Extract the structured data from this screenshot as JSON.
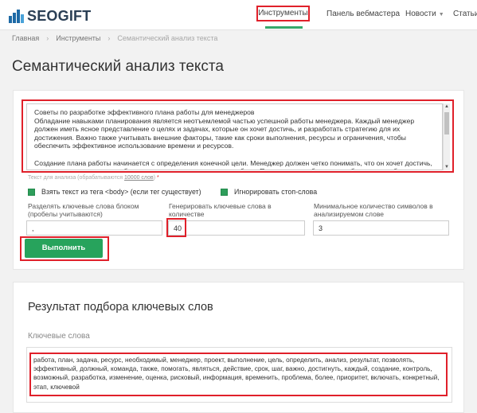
{
  "header": {
    "logo_seo": "SEO",
    "logo_gift": "GIFT",
    "nav": {
      "tools": "Инструменты",
      "webmaster": "Панель вебмастера",
      "news": "Новости",
      "articles": "Статьи"
    }
  },
  "breadcrumb": {
    "home": "Главная",
    "tools": "Инструменты",
    "current": "Семантический анализ текста"
  },
  "page_title": "Семантический анализ текста",
  "analyzer": {
    "text_paragraphs": [
      "Советы по разработке эффективного плана работы для менеджеров\nОбладание навыками планирования является неотъемлемой частью успешной работы менеджера. Каждый менеджер должен иметь ясное представление о целях и задачах, которые он хочет достичь, и разработать стратегию для их достижения. Важно также учитывать внешние факторы, такие как сроки выполнения, ресурсы и ограничения, чтобы обеспечить эффективное использование времени и ресурсов.",
      "Создание плана работы начинается с определения конечной цели. Менеджер должен четко понимать, что он хочет достичь, и какие результаты должны быть достигнуты в результате его работы. После этого необходимо разбить цель на более мелкие"
    ],
    "hint_prefix": "Текст для анализа (обрабатываются ",
    "hint_link": "10000 слов",
    "hint_suffix": ") ",
    "hint_star": "*",
    "checkbox_body": "Взять текст из тега <body> (если тег существует)",
    "checkbox_stopwords": "Игнорировать стоп-слова",
    "label_separator": "Разделять ключевые слова блоком (пробелы учитываются)",
    "label_count": "Генерировать ключевые слова в количестве",
    "label_minlen": "Минимальное количество символов в анализируемом слове",
    "value_separator": ",",
    "value_count": "40",
    "value_minlen": "3",
    "submit_label": "Выполнить"
  },
  "results": {
    "title": "Результат подбора ключевых слов",
    "keywords_label": "Ключевые слова",
    "keywords": "работа, план, задача, ресурс, необходимый, менеджер, проект, выполнение, цель, определить, анализ, результат, позволять, эффективный, должный, команда, также, помогать, являться, действие, срок, шаг, важно, достигнуть, каждый, создание, контроль, возможный, разработка, изменение, оценка, рисковый, информация, временить, проблема, более, приоритет, включать, конкретный, этап, ключевой"
  },
  "colors": {
    "accent_green": "#27a35c",
    "highlight_red": "#e0202a",
    "logo_blue": "#1e6aa6"
  }
}
